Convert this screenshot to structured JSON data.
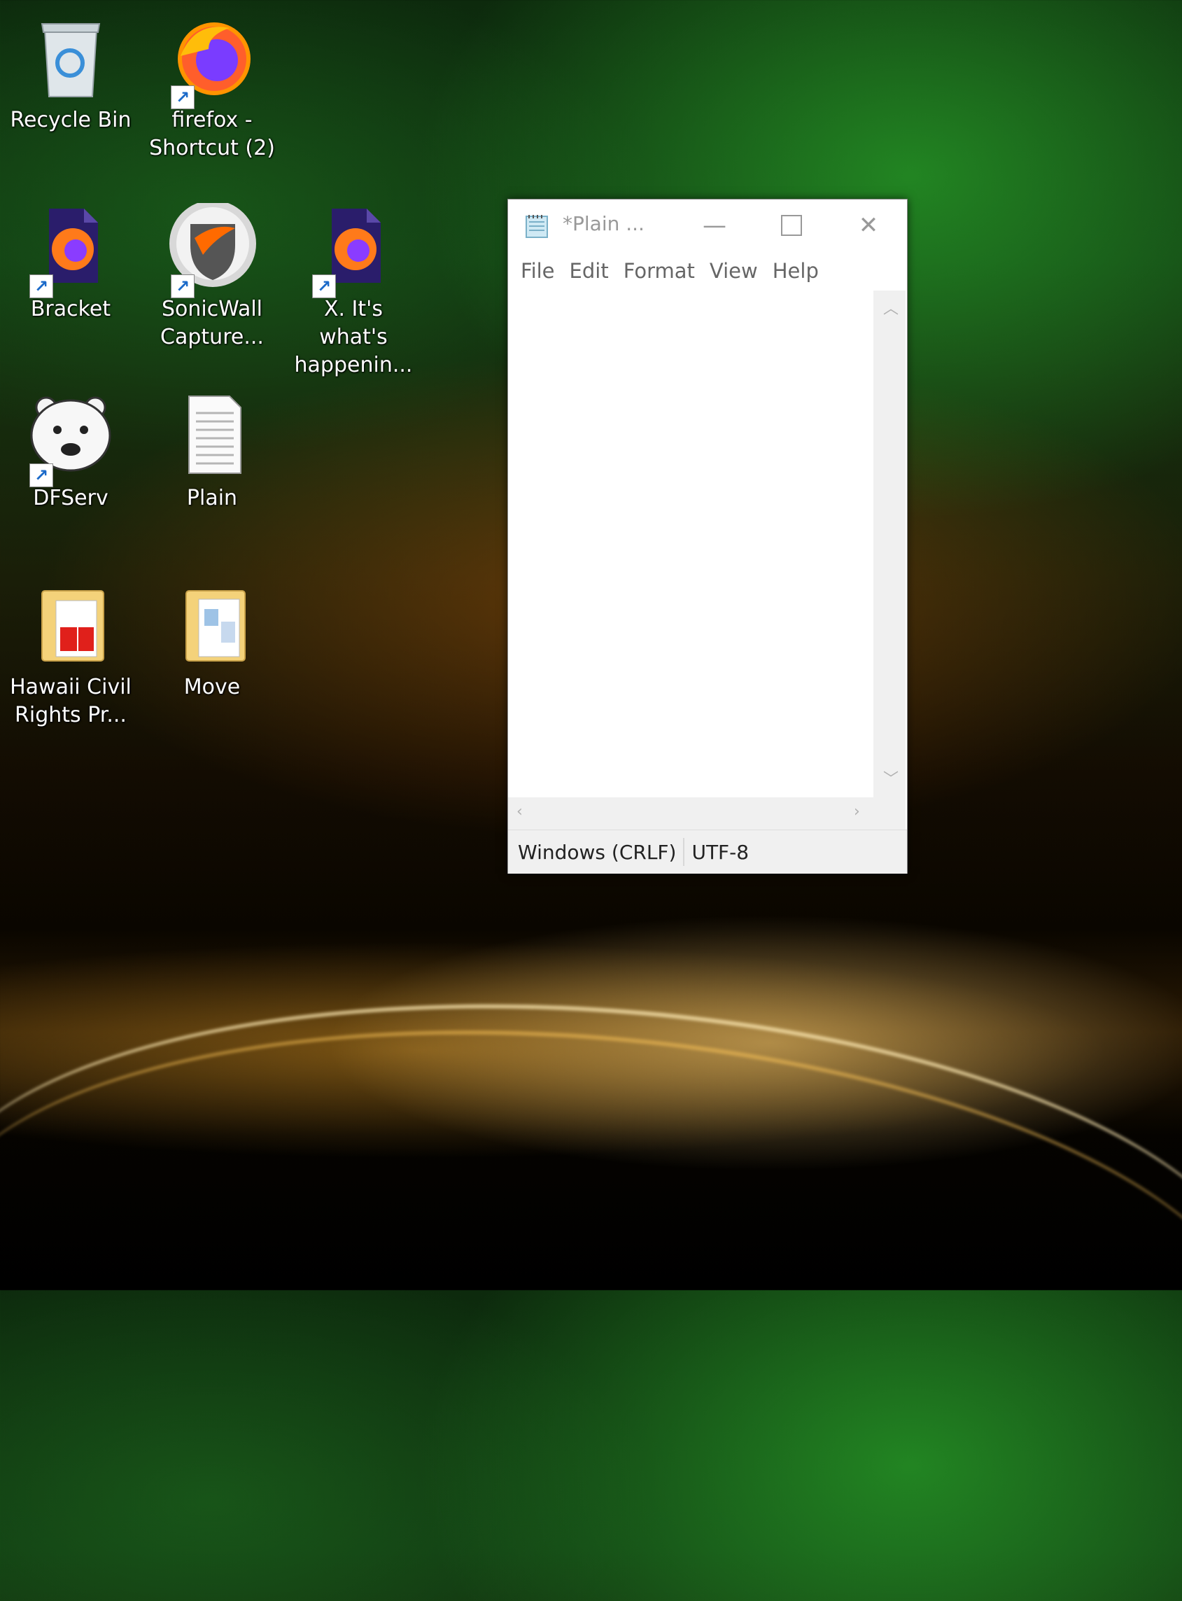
{
  "desktop": {
    "icons": [
      {
        "label": "Recycle Bin"
      },
      {
        "label": "firefox -\nShortcut (2)"
      },
      {
        "label": "Bracket"
      },
      {
        "label": "SonicWall\nCapture..."
      },
      {
        "label": "X. It's what's\nhappenin..."
      },
      {
        "label": "DFServ"
      },
      {
        "label": "Plain"
      },
      {
        "label": "Hawaii Civil\nRights Pr..."
      },
      {
        "label": "Move"
      }
    ]
  },
  "notepad": {
    "title": "*Plain ...",
    "menu": [
      "File",
      "Edit",
      "Format",
      "View",
      "Help"
    ],
    "content": "",
    "status": {
      "line_ending": "Windows (CRLF)",
      "encoding": "UTF-8"
    }
  }
}
